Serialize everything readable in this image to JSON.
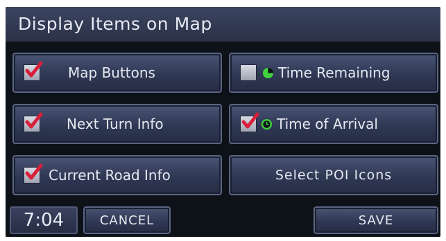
{
  "title": "Display Items on Map",
  "items": [
    {
      "label": "Map Buttons",
      "checked": true,
      "icon": "checkbox"
    },
    {
      "label": "Time Remaining",
      "checked": false,
      "icon": "clock-remaining-icon"
    },
    {
      "label": "Next Turn Info",
      "checked": true,
      "icon": "checkbox"
    },
    {
      "label": "Time of Arrival",
      "checked": true,
      "icon": "clock-arrival-icon"
    },
    {
      "label": "Current Road Info",
      "checked": true,
      "icon": "checkbox"
    },
    {
      "label": "Select POI Icons"
    }
  ],
  "bottom": {
    "time": "7:04",
    "cancel_label": "CANCEL",
    "save_label": "SAVE"
  },
  "colors": {
    "check_red": "#d8203a",
    "clock_green": "#3fd23a",
    "button_face": "#2f3854",
    "title_bar": "#323a54"
  }
}
